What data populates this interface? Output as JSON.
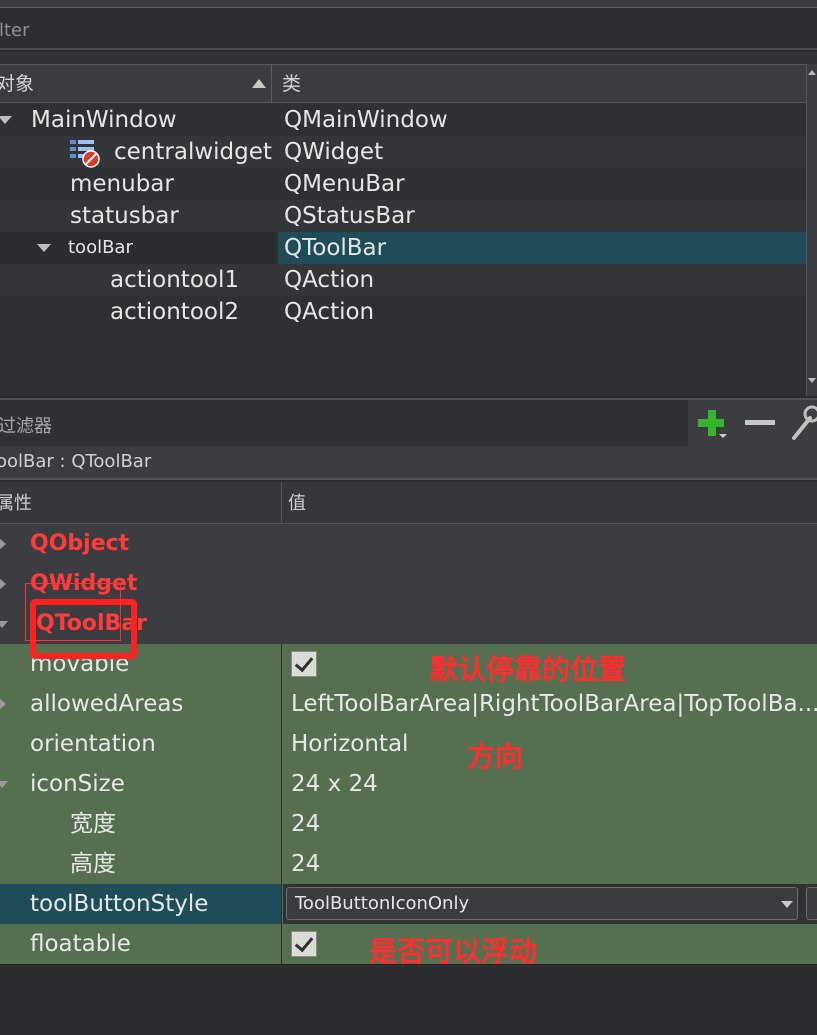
{
  "filter": {
    "placeholder": "ilter"
  },
  "object_tree": {
    "headers": {
      "object": "对象",
      "class": "类"
    },
    "rows": [
      {
        "name": "MainWindow",
        "class": "QMainWindow"
      },
      {
        "name": "centralwidget",
        "class": "QWidget"
      },
      {
        "name": "menubar",
        "class": "QMenuBar"
      },
      {
        "name": "statusbar",
        "class": "QStatusBar"
      },
      {
        "name": "toolBar",
        "class": "QToolBar"
      },
      {
        "name": "actiontool1",
        "class": "QAction"
      },
      {
        "name": "actiontool2",
        "class": "QAction"
      }
    ]
  },
  "property_editor": {
    "filter_label": "过滤器",
    "object_label": "oolBar : QToolBar",
    "headers": {
      "property": "属性",
      "value": "值"
    },
    "groups": {
      "qobject": "QObject",
      "qwidget": "QWidget",
      "qtoolbar": "QToolBar"
    },
    "props": {
      "movable": {
        "name": "movable",
        "checked": true
      },
      "allowedAreas": {
        "name": "allowedAreas",
        "value": "LeftToolBarArea|RightToolBarArea|TopToolBa..."
      },
      "orientation": {
        "name": "orientation",
        "value": "Horizontal"
      },
      "iconSize": {
        "name": "iconSize",
        "value": "24 x 24"
      },
      "width": {
        "name": "宽度",
        "value": "24"
      },
      "height": {
        "name": "高度",
        "value": "24"
      },
      "toolButtonStyle": {
        "name": "toolButtonStyle",
        "value": "ToolButtonIconOnly"
      },
      "floatable": {
        "name": "floatable",
        "checked": true
      }
    }
  },
  "annotations": {
    "default_dock": "默认停靠的位置",
    "direction": "方向",
    "floatable": "是否可以浮动"
  },
  "colors": {
    "annotation": "#ff2d2d",
    "selection": "#1f4d57",
    "toolbar_props": "#556f50"
  }
}
